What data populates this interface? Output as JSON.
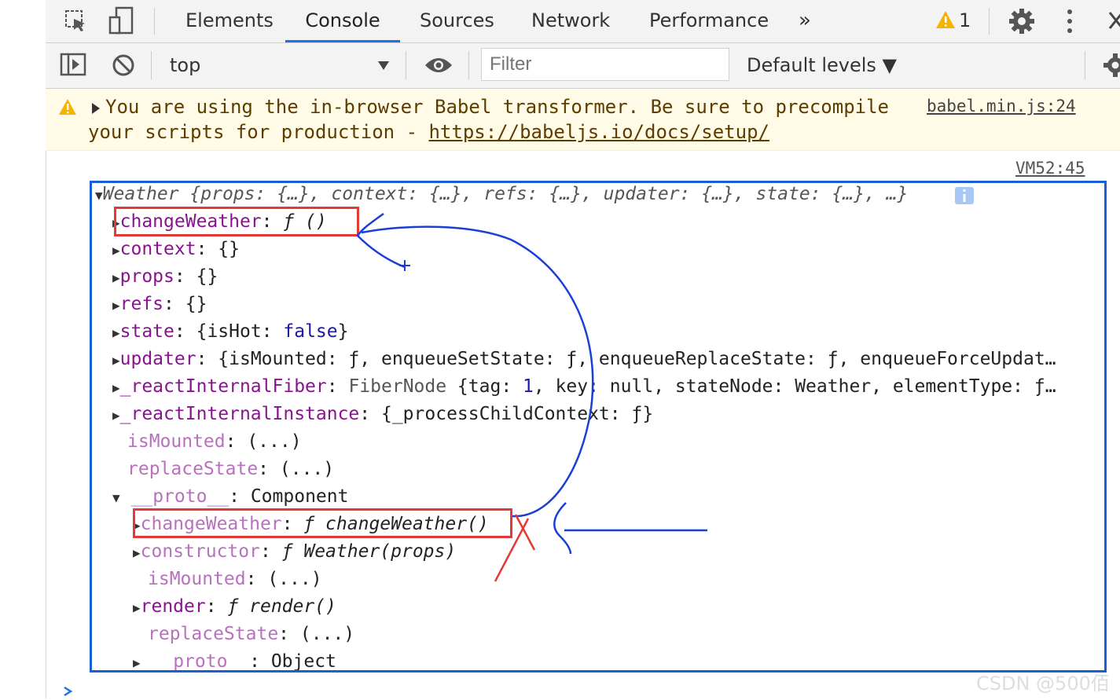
{
  "tabs": {
    "items": [
      "Elements",
      "Console",
      "Sources",
      "Network",
      "Performance"
    ],
    "more": "»",
    "warning_count": "1"
  },
  "toolbar": {
    "context": "top",
    "filter_placeholder": "Filter",
    "levels": "Default levels ▼"
  },
  "warning": {
    "line1": "You are using the in-browser Babel transformer. Be sure to precompile",
    "line2_prefix": "your scripts for production - ",
    "line2_link": "https://babeljs.io/docs/setup/",
    "source": "babel.min.js:24"
  },
  "log": {
    "source": "VM52:45",
    "summary": "Weather {props: {…}, context: {…}, refs: {…}, updater: {…}, state: {…}, …}",
    "rows": [
      {
        "key": "changeWeather",
        "value": "ƒ ()"
      },
      {
        "key": "context",
        "value": "{}"
      },
      {
        "key": "props",
        "value": "{}"
      },
      {
        "key": "refs",
        "value": "{}"
      },
      {
        "key": "state",
        "value_prefix": "{isHot: ",
        "value_bool": "false",
        "value_suffix": "}"
      },
      {
        "key": "updater",
        "value": "{isMounted: ƒ, enqueueSetState: ƒ, enqueueReplaceState: ƒ, enqueueForceUpdat…"
      },
      {
        "key": "_reactInternalFiber",
        "value_type": "FiberNode",
        "value_a": " {tag: ",
        "value_num": "1",
        "value_b": ", key: null, stateNode: Weather, elementType: ƒ…"
      },
      {
        "key": "_reactInternalInstance",
        "value": "{_processChildContext: ƒ}"
      },
      {
        "key": "isMounted",
        "value": "(...)"
      },
      {
        "key": "replaceState",
        "value": "(...)"
      },
      {
        "key": "__proto__",
        "value": "Component"
      }
    ],
    "proto_rows": [
      {
        "key": "changeWeather",
        "value": "ƒ changeWeather()"
      },
      {
        "key": "constructor",
        "value": "ƒ Weather(props)"
      },
      {
        "key": "isMounted",
        "value": "(...)"
      },
      {
        "key": "render",
        "value": "ƒ render()"
      },
      {
        "key": "replaceState",
        "value": "(...)"
      },
      {
        "key": "__proto__",
        "value": "Object"
      }
    ]
  },
  "watermark": "CSDN @500佰",
  "colors": {
    "accent": "#1a73e8",
    "annotation_blue": "#1a3fd6",
    "annotation_red": "#e53935",
    "key_purple": "#881391"
  }
}
